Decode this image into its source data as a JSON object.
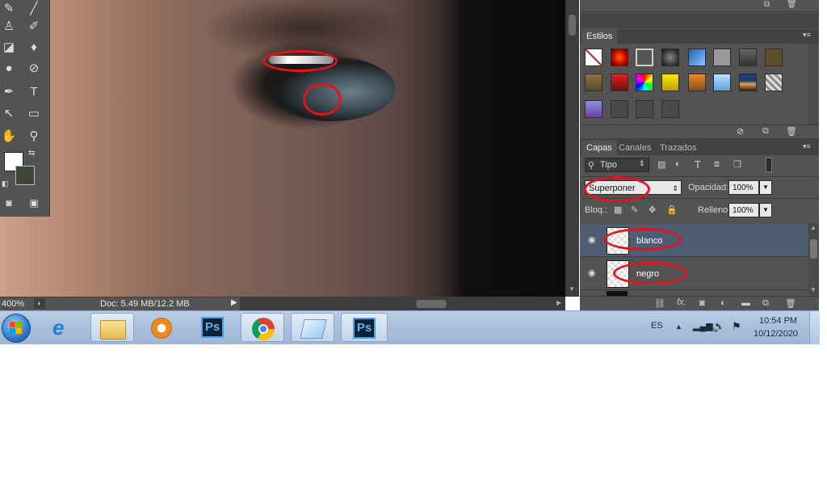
{
  "canvas": {
    "zoom": "400%",
    "doc_info": "Doc: 5.49 MB/12.2 MB"
  },
  "panels": {
    "styles_tab": "Estilos",
    "layers_tabs": [
      "Capas",
      "Canales",
      "Trazados"
    ],
    "filter_kind": "Tipo",
    "blend_mode": "Superponer",
    "opacity_label": "Opacidad:",
    "opacity_value": "100%",
    "lock_label": "Bloq.:",
    "fill_label": "Relleno:",
    "fill_value": "100%",
    "layers": [
      {
        "name": "blanco",
        "selected": true
      },
      {
        "name": "negro",
        "selected": false
      }
    ]
  },
  "taskbar": {
    "language": "ES",
    "time": "10:54 PM",
    "date": "10/12/2020",
    "ps_label": "Ps"
  },
  "colors": {
    "annotation": "#e3131b",
    "selected_layer": "#4f5d73",
    "panel_bg": "#535353"
  }
}
